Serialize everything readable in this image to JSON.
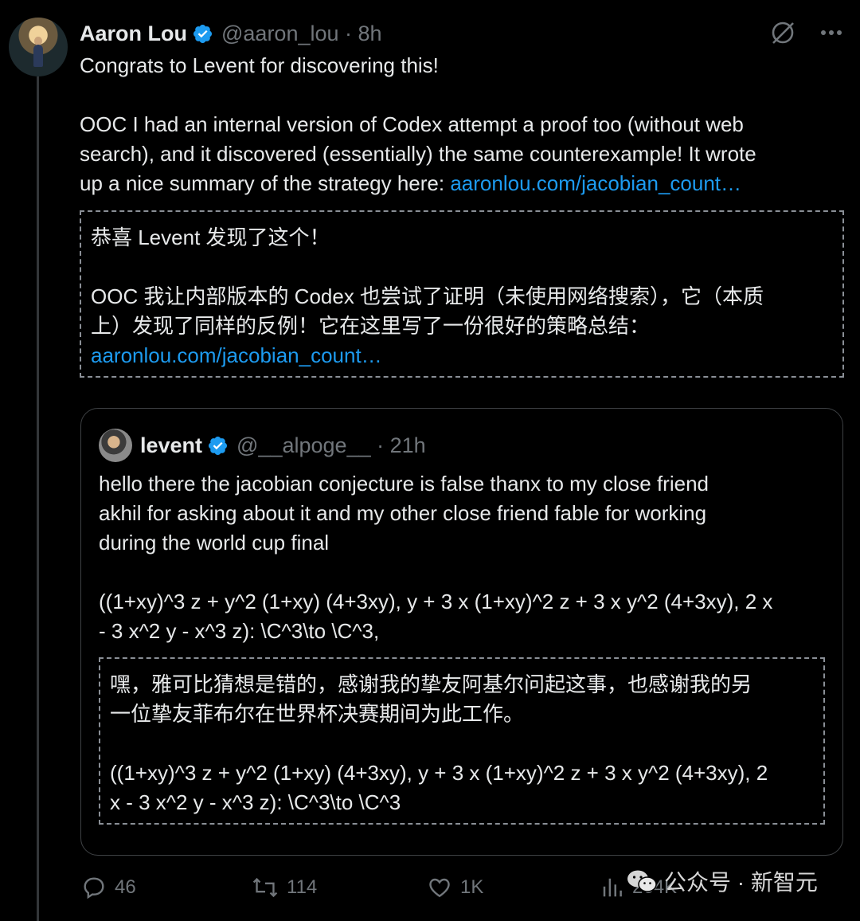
{
  "post": {
    "author_name": "Aaron Lou",
    "author_handle": "@aaron_lou · 8h",
    "line1": "Congrats to Levent for discovering this!",
    "para2_a": "OOC I had an internal version of Codex attempt a proof too (without web",
    "para2_b": "search), and it discovered (essentially) the same counterexample! It wrote",
    "para2_c": "up a nice summary of the strategy here: ",
    "link": "aaronlou.com/jacobian_count…"
  },
  "translation_post": {
    "line1": "恭喜 Levent 发现了这个！",
    "line2": "OOC 我让内部版本的 Codex 也尝试了证明（未使用网络搜索），它（本质",
    "line3": "上）发现了同样的反例！它在这里写了一份很好的策略总结：",
    "link": "aaronlou.com/jacobian_count…"
  },
  "quote": {
    "author_name": "levent",
    "author_handle": "@__alpoge__ · 21h",
    "line1": "hello there the jacobian conjecture is false thanx to my close friend",
    "line2": "akhil for asking about it and my other close friend fable for working",
    "line3": "during the world cup final",
    "formula1": "((1+xy)^3 z + y^2 (1+xy) (4+3xy), y + 3 x (1+xy)^2  z + 3 x y^2 (4+3xy), 2 x",
    "formula2": "- 3 x^2 y - x^3 z): \\C^3\\to \\C^3,"
  },
  "translation_quote": {
    "line1": "嘿，雅可比猜想是错的，感谢我的挚友阿基尔问起这事，也感谢我的另",
    "line2": "一位挚友菲布尔在世界杯决赛期间为此工作。",
    "formula1": "((1+xy)^3 z + y^2 (1+xy) (4+3xy), y + 3 x (1+xy)^2 z + 3 x y^2 (4+3xy), 2",
    "formula2": "x - 3 x^2 y - x^3 z): \\C^3\\to \\C^3"
  },
  "actions": {
    "replies": "46",
    "reposts": "114",
    "likes": "1K",
    "views": "264K"
  },
  "watermark": {
    "text": "公众号 · 新智元"
  },
  "colors": {
    "background": "#000000",
    "text": "#e7e9ea",
    "muted": "#71767b",
    "link": "#1d9bf0",
    "verified": "#1d9bf0"
  }
}
